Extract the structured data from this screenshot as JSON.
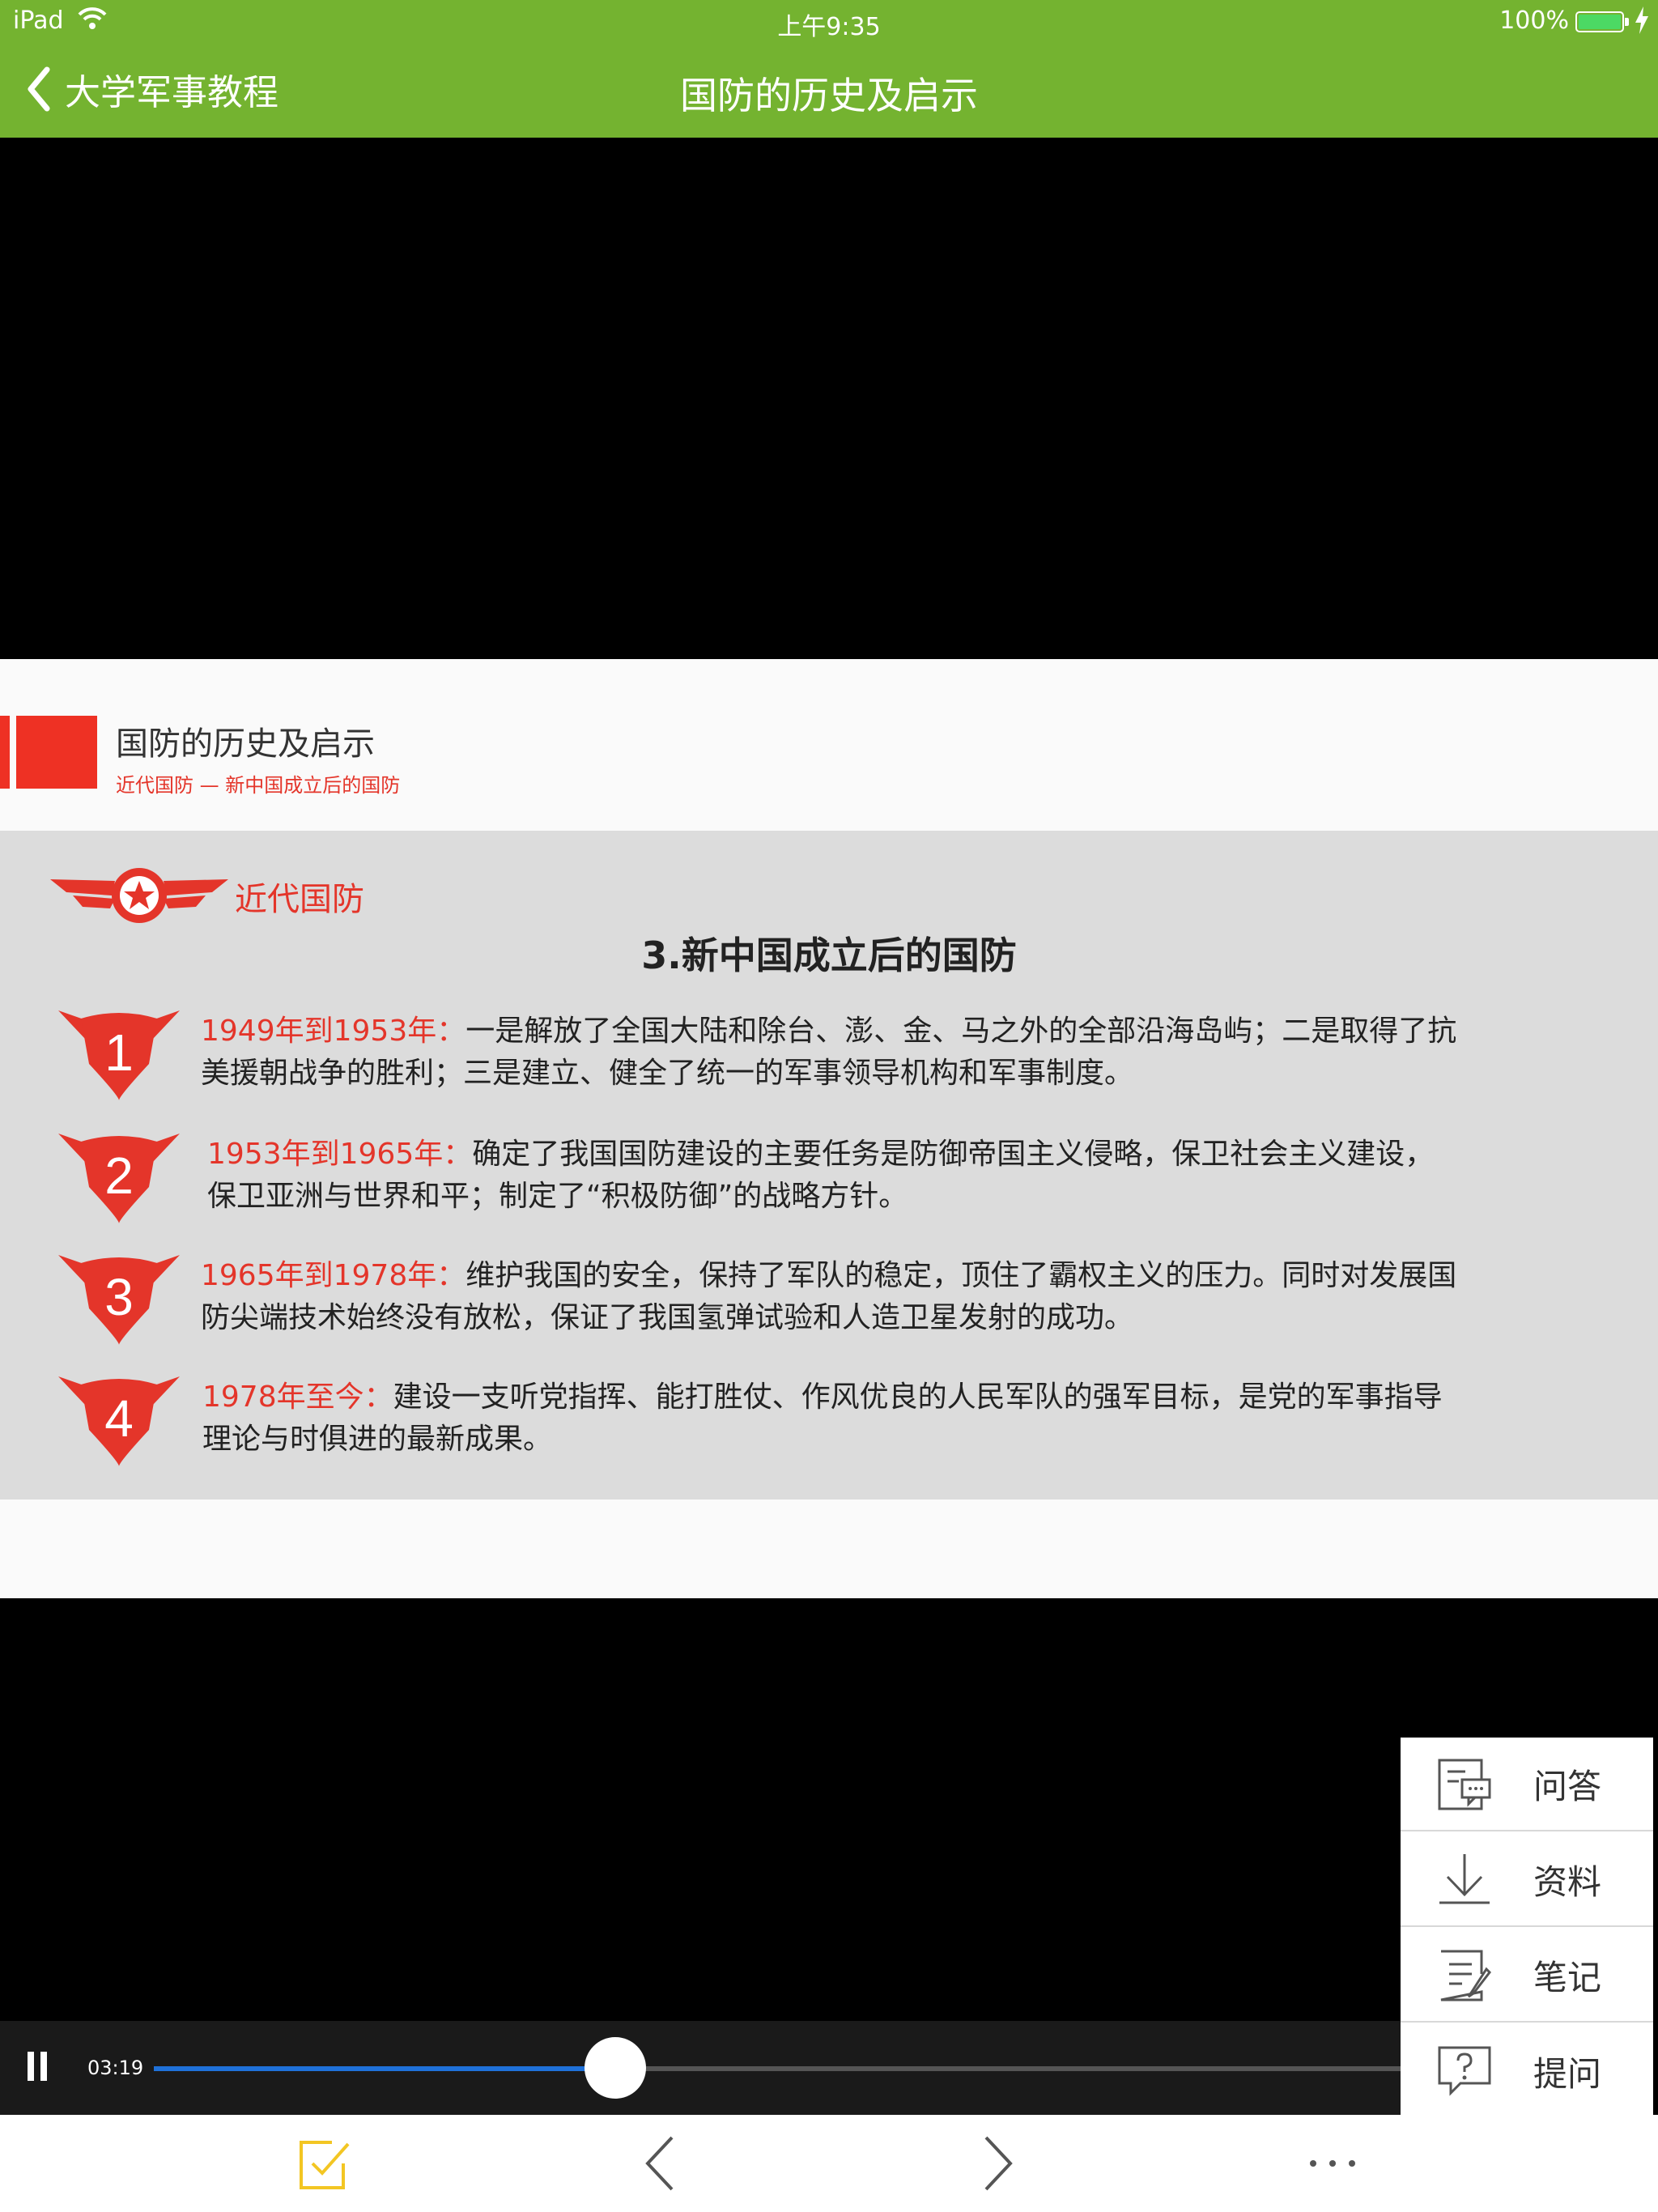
{
  "status_bar": {
    "device": "iPad",
    "time": "上午9:35",
    "battery": "100%"
  },
  "nav": {
    "back_label": "大学军事教程",
    "title": "国防的历史及启示"
  },
  "slide": {
    "title": "国防的历史及启示",
    "subtitle": "近代国防 — 新中国成立后的国防",
    "section_label": "近代国防",
    "heading": "3.新中国成立后的国防",
    "items": [
      {
        "number": "1",
        "date": "1949年到1953年：",
        "line1_rest": "一是解放了全国大陆和除台、澎、金、马之外的全部沿海岛屿；二是取得了抗",
        "line2": "美援朝战争的胜利；三是建立、健全了统一的军事领导机构和军事制度。"
      },
      {
        "number": "2",
        "date": "1953年到1965年：",
        "line1_rest": "确定了我国国防建设的主要任务是防御帝国主义侵略，保卫社会主义建设，",
        "line2": "保卫亚洲与世界和平；制定了“积极防御”的战略方针。"
      },
      {
        "number": "3",
        "date": "1965年到1978年：",
        "line1_rest": "维护我国的安全，保持了军队的稳定，顶住了霸权主义的压力。同时对发展国",
        "line2": "防尖端技术始终没有放松，保证了我国氢弹试验和人造卫星发射的成功。"
      },
      {
        "number": "4",
        "date": "1978年至今：",
        "line1_rest": "建设一支听党指挥、能打胜仗、作风优良的人民军队的强军目标，是党的军事指导",
        "line2": "理论与时俱进的最新成果。"
      }
    ]
  },
  "side_menu": [
    {
      "label": "问答",
      "icon": "qa-icon"
    },
    {
      "label": "资料",
      "icon": "download-icon"
    },
    {
      "label": "笔记",
      "icon": "note-icon"
    },
    {
      "label": "提问",
      "icon": "question-icon"
    }
  ],
  "player": {
    "elapsed": "03:19",
    "progress": 0.37
  },
  "toolbar": {
    "icons": [
      "checklist-icon",
      "previous-icon",
      "next-icon",
      "more-icon"
    ]
  },
  "colors": {
    "nav_green": "#74b330",
    "accent_red": "#e4352a",
    "progress_blue": "#1f71d9",
    "toolbar_icon_yellow": "#f3c623"
  }
}
